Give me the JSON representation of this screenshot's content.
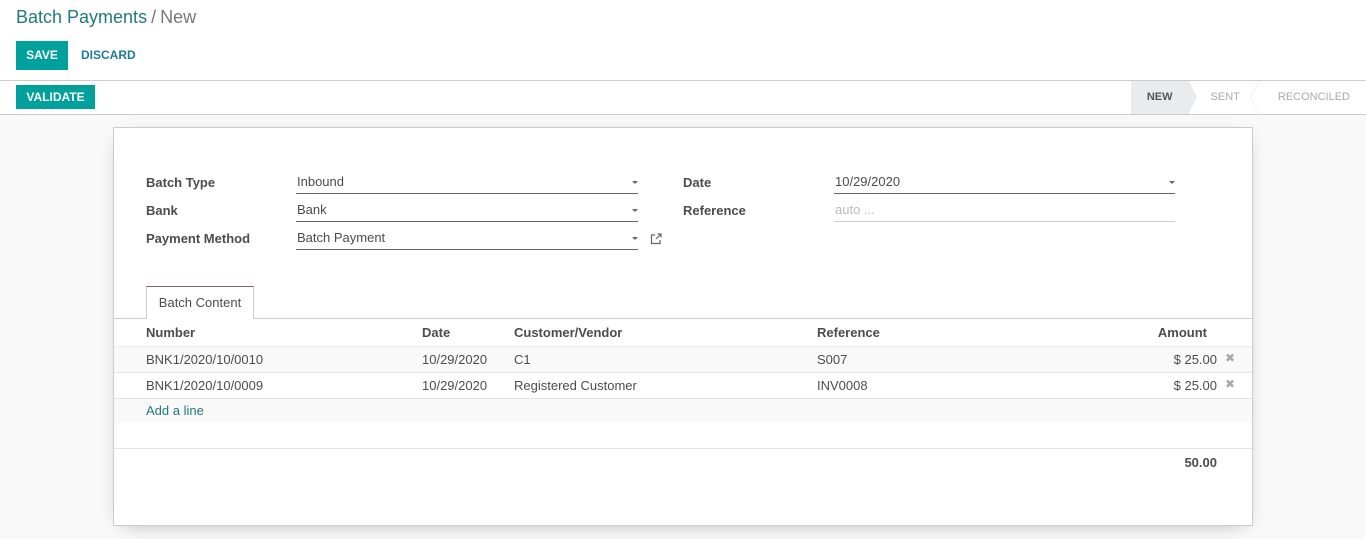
{
  "breadcrumb": {
    "parent": "Batch Payments",
    "separator": "/",
    "current": "New"
  },
  "toolbar": {
    "save_label": "SAVE",
    "discard_label": "DISCARD"
  },
  "statusbar": {
    "validate_label": "VALIDATE",
    "stages": [
      {
        "label": "NEW",
        "active": true
      },
      {
        "label": "SENT",
        "active": false
      },
      {
        "label": "RECONCILED",
        "active": false
      }
    ]
  },
  "form": {
    "batch_type": {
      "label": "Batch Type",
      "value": "Inbound"
    },
    "bank": {
      "label": "Bank",
      "value": "Bank"
    },
    "payment_method": {
      "label": "Payment Method",
      "value": "Batch Payment"
    },
    "date": {
      "label": "Date",
      "value": "10/29/2020"
    },
    "reference": {
      "label": "Reference",
      "placeholder": "auto ..."
    }
  },
  "tabs": [
    {
      "label": "Batch Content"
    }
  ],
  "table": {
    "columns": [
      "Number",
      "Date",
      "Customer/Vendor",
      "Reference",
      "Amount"
    ],
    "rows": [
      {
        "number": "BNK1/2020/10/0010",
        "date": "10/29/2020",
        "partner": "C1",
        "reference": "S007",
        "amount": "$ 25.00"
      },
      {
        "number": "BNK1/2020/10/0009",
        "date": "10/29/2020",
        "partner": "Registered Customer",
        "reference": "INV0008",
        "amount": "$ 25.00"
      }
    ],
    "add_line_label": "Add a line",
    "total": "50.00"
  },
  "icons": {
    "delete": "times-icon",
    "external_link": "external-link-icon",
    "dropdown": "caret-down-icon"
  },
  "colors": {
    "primary": "#00a09d",
    "link": "#1f7a7a",
    "tab_accent": "#7c5f7c"
  }
}
